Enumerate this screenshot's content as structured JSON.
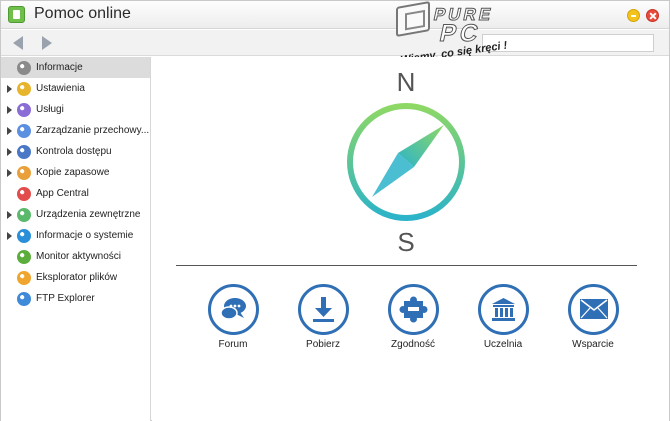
{
  "window": {
    "title": "Pomoc online"
  },
  "toolbar": {
    "search_value": ""
  },
  "watermark": {
    "pure": "PURE",
    "pc": "PC",
    "slogan": "Wiemy, co się kręci !"
  },
  "sidebar": {
    "items": [
      {
        "label": "Informacje",
        "icon": "compass-icon",
        "color": "#8a8a8a",
        "expandable": false,
        "active": true
      },
      {
        "label": "Ustawienia",
        "icon": "gear-icon",
        "color": "#e7b52b",
        "expandable": true,
        "active": false
      },
      {
        "label": "Usługi",
        "icon": "services-icon",
        "color": "#8b6dd6",
        "expandable": true,
        "active": false
      },
      {
        "label": "Zarządzanie przechowy...",
        "icon": "storage-icon",
        "color": "#5b8fe0",
        "expandable": true,
        "active": false
      },
      {
        "label": "Kontrola dostępu",
        "icon": "access-control-icon",
        "color": "#4a78c7",
        "expandable": true,
        "active": false
      },
      {
        "label": "Kopie zapasowe",
        "icon": "backup-icon",
        "color": "#e9a03a",
        "expandable": true,
        "active": false
      },
      {
        "label": "App Central",
        "icon": "app-central-icon",
        "color": "#e24c4c",
        "expandable": false,
        "active": false
      },
      {
        "label": "Urządzenia zewnętrzne",
        "icon": "external-devices-icon",
        "color": "#5bb96b",
        "expandable": true,
        "active": false
      },
      {
        "label": "Informacje o systemie",
        "icon": "system-info-icon",
        "color": "#2a8fd8",
        "expandable": true,
        "active": false
      },
      {
        "label": "Monitor aktywności",
        "icon": "activity-monitor-icon",
        "color": "#5cae3c",
        "expandable": false,
        "active": false
      },
      {
        "label": "Eksplorator plików",
        "icon": "file-explorer-icon",
        "color": "#f0a52e",
        "expandable": false,
        "active": false
      },
      {
        "label": "FTP Explorer",
        "icon": "ftp-explorer-icon",
        "color": "#3f8ad9",
        "expandable": false,
        "active": false
      }
    ]
  },
  "compass": {
    "north": "N",
    "south": "S",
    "ring_color_top": "#8ed865",
    "ring_color_bottom": "#2bb3c9"
  },
  "links": [
    {
      "label": "Forum",
      "icon": "chat-bubbles-icon"
    },
    {
      "label": "Pobierz",
      "icon": "download-icon"
    },
    {
      "label": "Zgodność",
      "icon": "puzzle-icon"
    },
    {
      "label": "Uczelnia",
      "icon": "university-icon"
    },
    {
      "label": "Wsparcie",
      "icon": "envelope-icon"
    }
  ],
  "colors": {
    "accent": "#2f6fb5",
    "selection": "#dcdcdc"
  }
}
